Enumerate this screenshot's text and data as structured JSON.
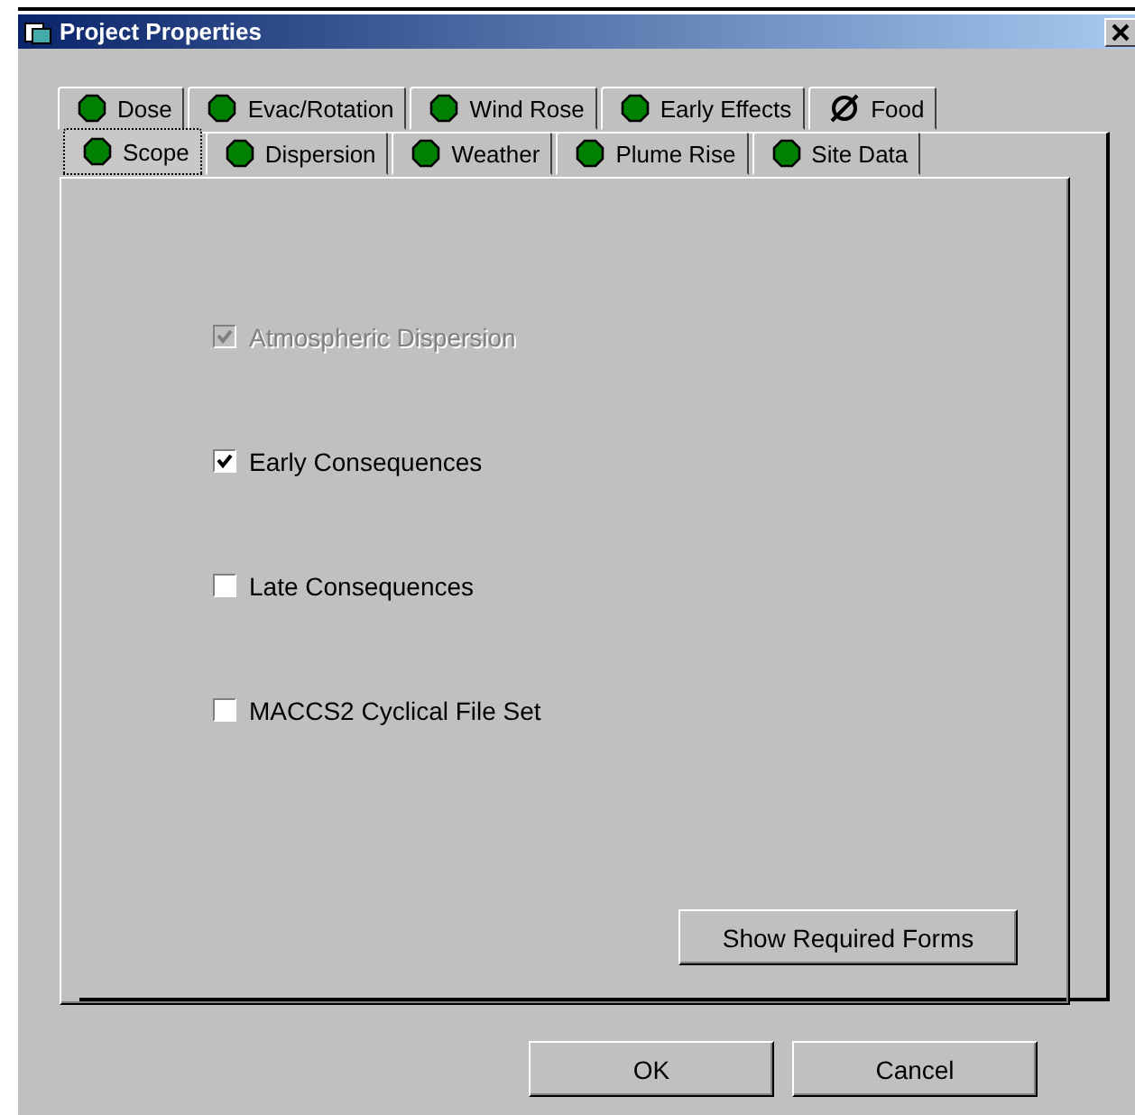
{
  "window": {
    "title": "Project Properties"
  },
  "tab_rows": [
    {
      "tabs": [
        {
          "label": "Dose",
          "kind": "ok",
          "selected": false
        },
        {
          "label": "Evac/Rotation",
          "kind": "ok",
          "selected": false
        },
        {
          "label": "Wind Rose",
          "kind": "ok",
          "selected": false
        },
        {
          "label": "Early Effects",
          "kind": "ok",
          "selected": false
        },
        {
          "label": "Food",
          "kind": "none",
          "selected": false
        }
      ]
    },
    {
      "tabs": [
        {
          "label": "Scope",
          "kind": "ok",
          "selected": true
        },
        {
          "label": "Dispersion",
          "kind": "ok",
          "selected": false
        },
        {
          "label": "Weather",
          "kind": "ok",
          "selected": false
        },
        {
          "label": "Plume Rise",
          "kind": "ok",
          "selected": false
        },
        {
          "label": "Site Data",
          "kind": "ok",
          "selected": false
        }
      ]
    }
  ],
  "options": [
    {
      "label": "Atmospheric Dispersion",
      "checked": true,
      "disabled": true
    },
    {
      "label": "Early Consequences",
      "checked": true,
      "disabled": false
    },
    {
      "label": "Late Consequences",
      "checked": false,
      "disabled": false
    },
    {
      "label": "MACCS2 Cyclical File Set",
      "checked": false,
      "disabled": false
    }
  ],
  "panel_button": "Show Required Forms",
  "buttons": [
    "OK",
    "Cancel"
  ]
}
